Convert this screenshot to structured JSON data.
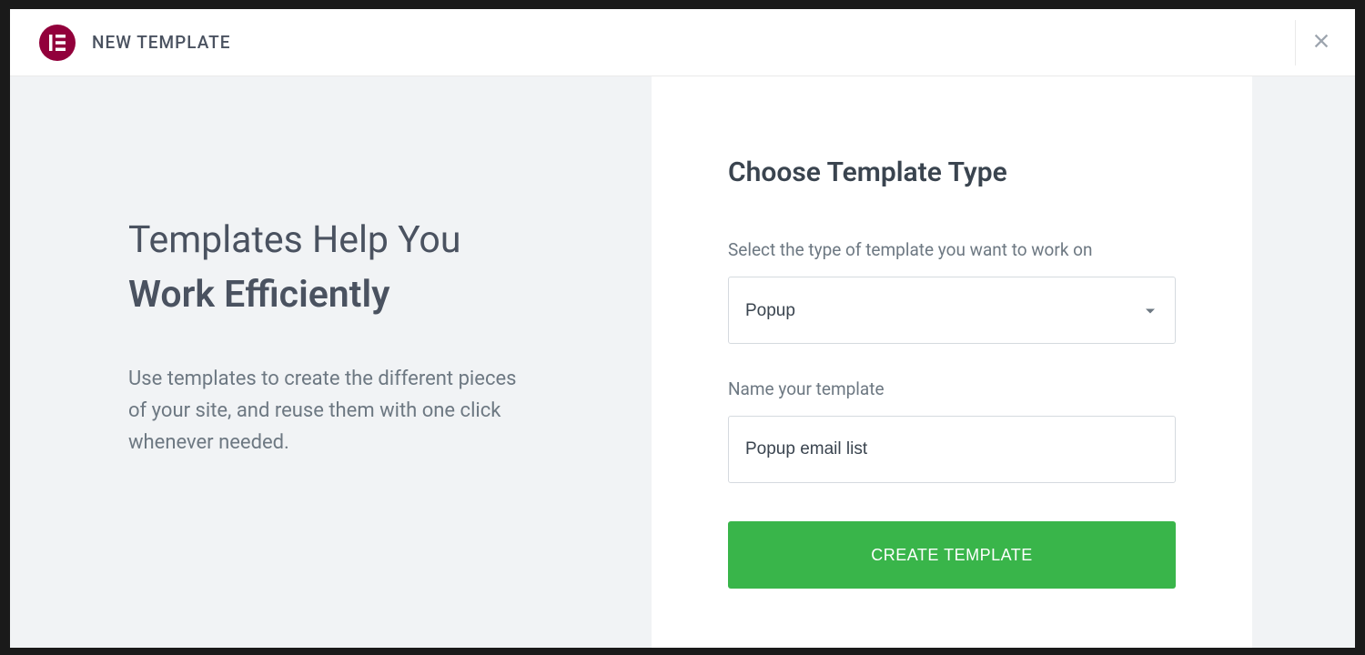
{
  "header": {
    "logo_text": "E",
    "title": "NEW TEMPLATE"
  },
  "left": {
    "heading_line1": "Templates Help You",
    "heading_line2": "Work Efficiently",
    "description": "Use templates to create the different pieces of your site, and reuse them with one click whenever needed."
  },
  "form": {
    "title": "Choose Template Type",
    "type_label": "Select the type of template you want to work on",
    "type_value": "Popup",
    "name_label": "Name your template",
    "name_value": "Popup email list",
    "submit_label": "CREATE TEMPLATE"
  }
}
